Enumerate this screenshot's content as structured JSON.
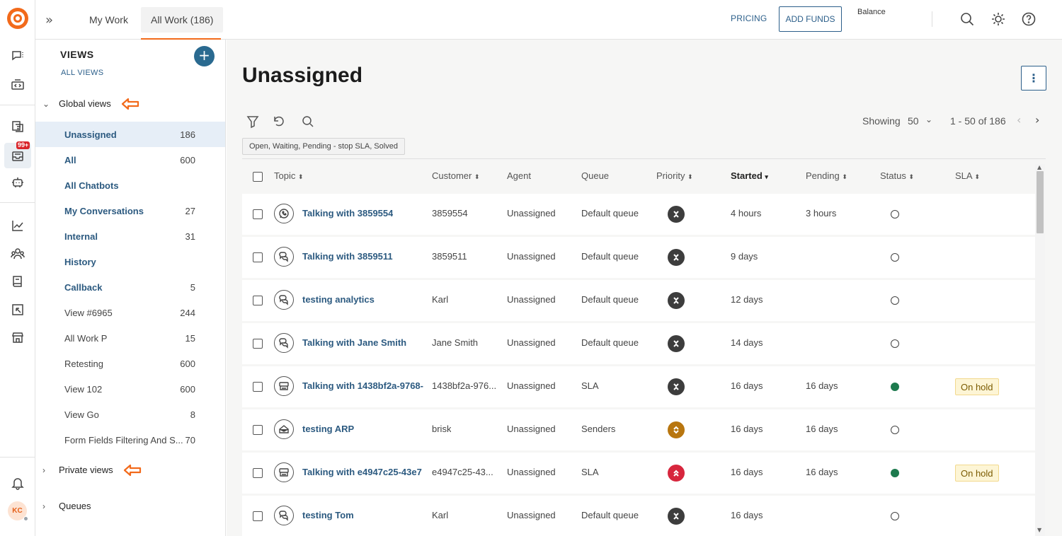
{
  "topbar": {
    "tabs": [
      {
        "label": "My Work",
        "active": false
      },
      {
        "label": "All Work (186)",
        "active": true
      }
    ],
    "pricing": "PRICING",
    "add_funds": "ADD FUNDS",
    "balance": "Balance",
    "icons": [
      "search-icon",
      "sun-icon",
      "help-icon"
    ]
  },
  "rail": {
    "icons": [
      "conversations-icon",
      "code-icon",
      "knowledge-icon",
      "inbox-icon",
      "bot-icon",
      "analytics-icon",
      "contacts-icon",
      "book-icon",
      "portal-icon",
      "store-icon",
      "bell-icon"
    ],
    "badge": "99+",
    "avatar_initials": "KC"
  },
  "sidebar": {
    "title": "VIEWS",
    "all_views": "ALL VIEWS",
    "global_views": "Global views",
    "private_views": "Private views",
    "queues": "Queues",
    "items": [
      {
        "label": "Unassigned",
        "count": "186",
        "bold": true,
        "selected": true
      },
      {
        "label": "All",
        "count": "600",
        "bold": true
      },
      {
        "label": "All Chatbots",
        "count": "",
        "bold": true
      },
      {
        "label": "My Conversations",
        "count": "27",
        "bold": true
      },
      {
        "label": "Internal",
        "count": "31",
        "bold": true
      },
      {
        "label": "History",
        "count": "",
        "bold": true
      },
      {
        "label": "Callback",
        "count": "5",
        "bold": true
      },
      {
        "label": "View  #6965",
        "count": "244",
        "bold": false
      },
      {
        "label": "All Work P",
        "count": "15",
        "bold": false
      },
      {
        "label": "Retesting",
        "count": "600",
        "bold": false
      },
      {
        "label": "View 102",
        "count": "600",
        "bold": false
      },
      {
        "label": "View Go",
        "count": "8",
        "bold": false
      },
      {
        "label": "Form Fields Filtering And S...",
        "count": "70",
        "bold": false
      }
    ]
  },
  "main": {
    "title": "Unassigned",
    "showing_label": "Showing",
    "page_size": "50",
    "range": "1 - 50 of 186",
    "filter_chip": "Open, Waiting, Pending - stop SLA, Solved",
    "columns": [
      "Topic",
      "Customer",
      "Agent",
      "Queue",
      "Priority",
      "Started",
      "Pending",
      "Status",
      "SLA"
    ],
    "sort_markers": {
      "Topic": "⬍",
      "Customer": "⬍",
      "Priority": "⬍",
      "Started": "▾",
      "Pending": "⬍",
      "Status": "⬍",
      "SLA": "⬍"
    },
    "rows": [
      {
        "channel": "whatsapp",
        "topic": "Talking with 3859554",
        "customer": "3859554",
        "agent": "Unassigned",
        "queue": "Default queue",
        "priority": "none",
        "started": "4 hours",
        "pending": "3 hours",
        "status": "open",
        "sla": ""
      },
      {
        "channel": "chat",
        "topic": "Talking with 3859511",
        "customer": "3859511",
        "agent": "Unassigned",
        "queue": "Default queue",
        "priority": "none",
        "started": "9 days",
        "pending": "",
        "status": "open",
        "sla": ""
      },
      {
        "channel": "chat",
        "topic": "testing analytics",
        "customer": "Karl",
        "agent": "Unassigned",
        "queue": "Default queue",
        "priority": "none",
        "started": "12 days",
        "pending": "",
        "status": "open",
        "sla": ""
      },
      {
        "channel": "chat",
        "topic": "Talking with Jane Smith",
        "customer": "Jane Smith",
        "agent": "Unassigned",
        "queue": "Default queue",
        "priority": "none",
        "started": "14 days",
        "pending": "",
        "status": "open",
        "sla": ""
      },
      {
        "channel": "sms",
        "topic": "Talking with 1438bf2a-9768-",
        "customer": "1438bf2a-976...",
        "agent": "Unassigned",
        "queue": "SLA",
        "priority": "none",
        "started": "16 days",
        "pending": "16 days",
        "status": "hold",
        "sla": "On hold"
      },
      {
        "channel": "email",
        "topic": "testing ARP",
        "customer": "brisk",
        "agent": "Unassigned",
        "queue": "Senders",
        "priority": "medium",
        "started": "16 days",
        "pending": "16 days",
        "status": "open",
        "sla": ""
      },
      {
        "channel": "sms",
        "topic": "Talking with e4947c25-43e7",
        "customer": "e4947c25-43...",
        "agent": "Unassigned",
        "queue": "SLA",
        "priority": "high",
        "started": "16 days",
        "pending": "16 days",
        "status": "hold",
        "sla": "On hold"
      },
      {
        "channel": "chat",
        "topic": "testing Tom",
        "customer": "Karl",
        "agent": "Unassigned",
        "queue": "Default queue",
        "priority": "none",
        "started": "16 days",
        "pending": "",
        "status": "open",
        "sla": ""
      }
    ]
  },
  "colors": {
    "brand": "#f26a1b",
    "link": "#2c5a80",
    "priority_none": "#3d3d3d",
    "priority_medium": "#b8760f",
    "priority_high": "#d7263d",
    "status_hold": "#1d7a4e",
    "annotation_arrow": "#f26a1b"
  }
}
